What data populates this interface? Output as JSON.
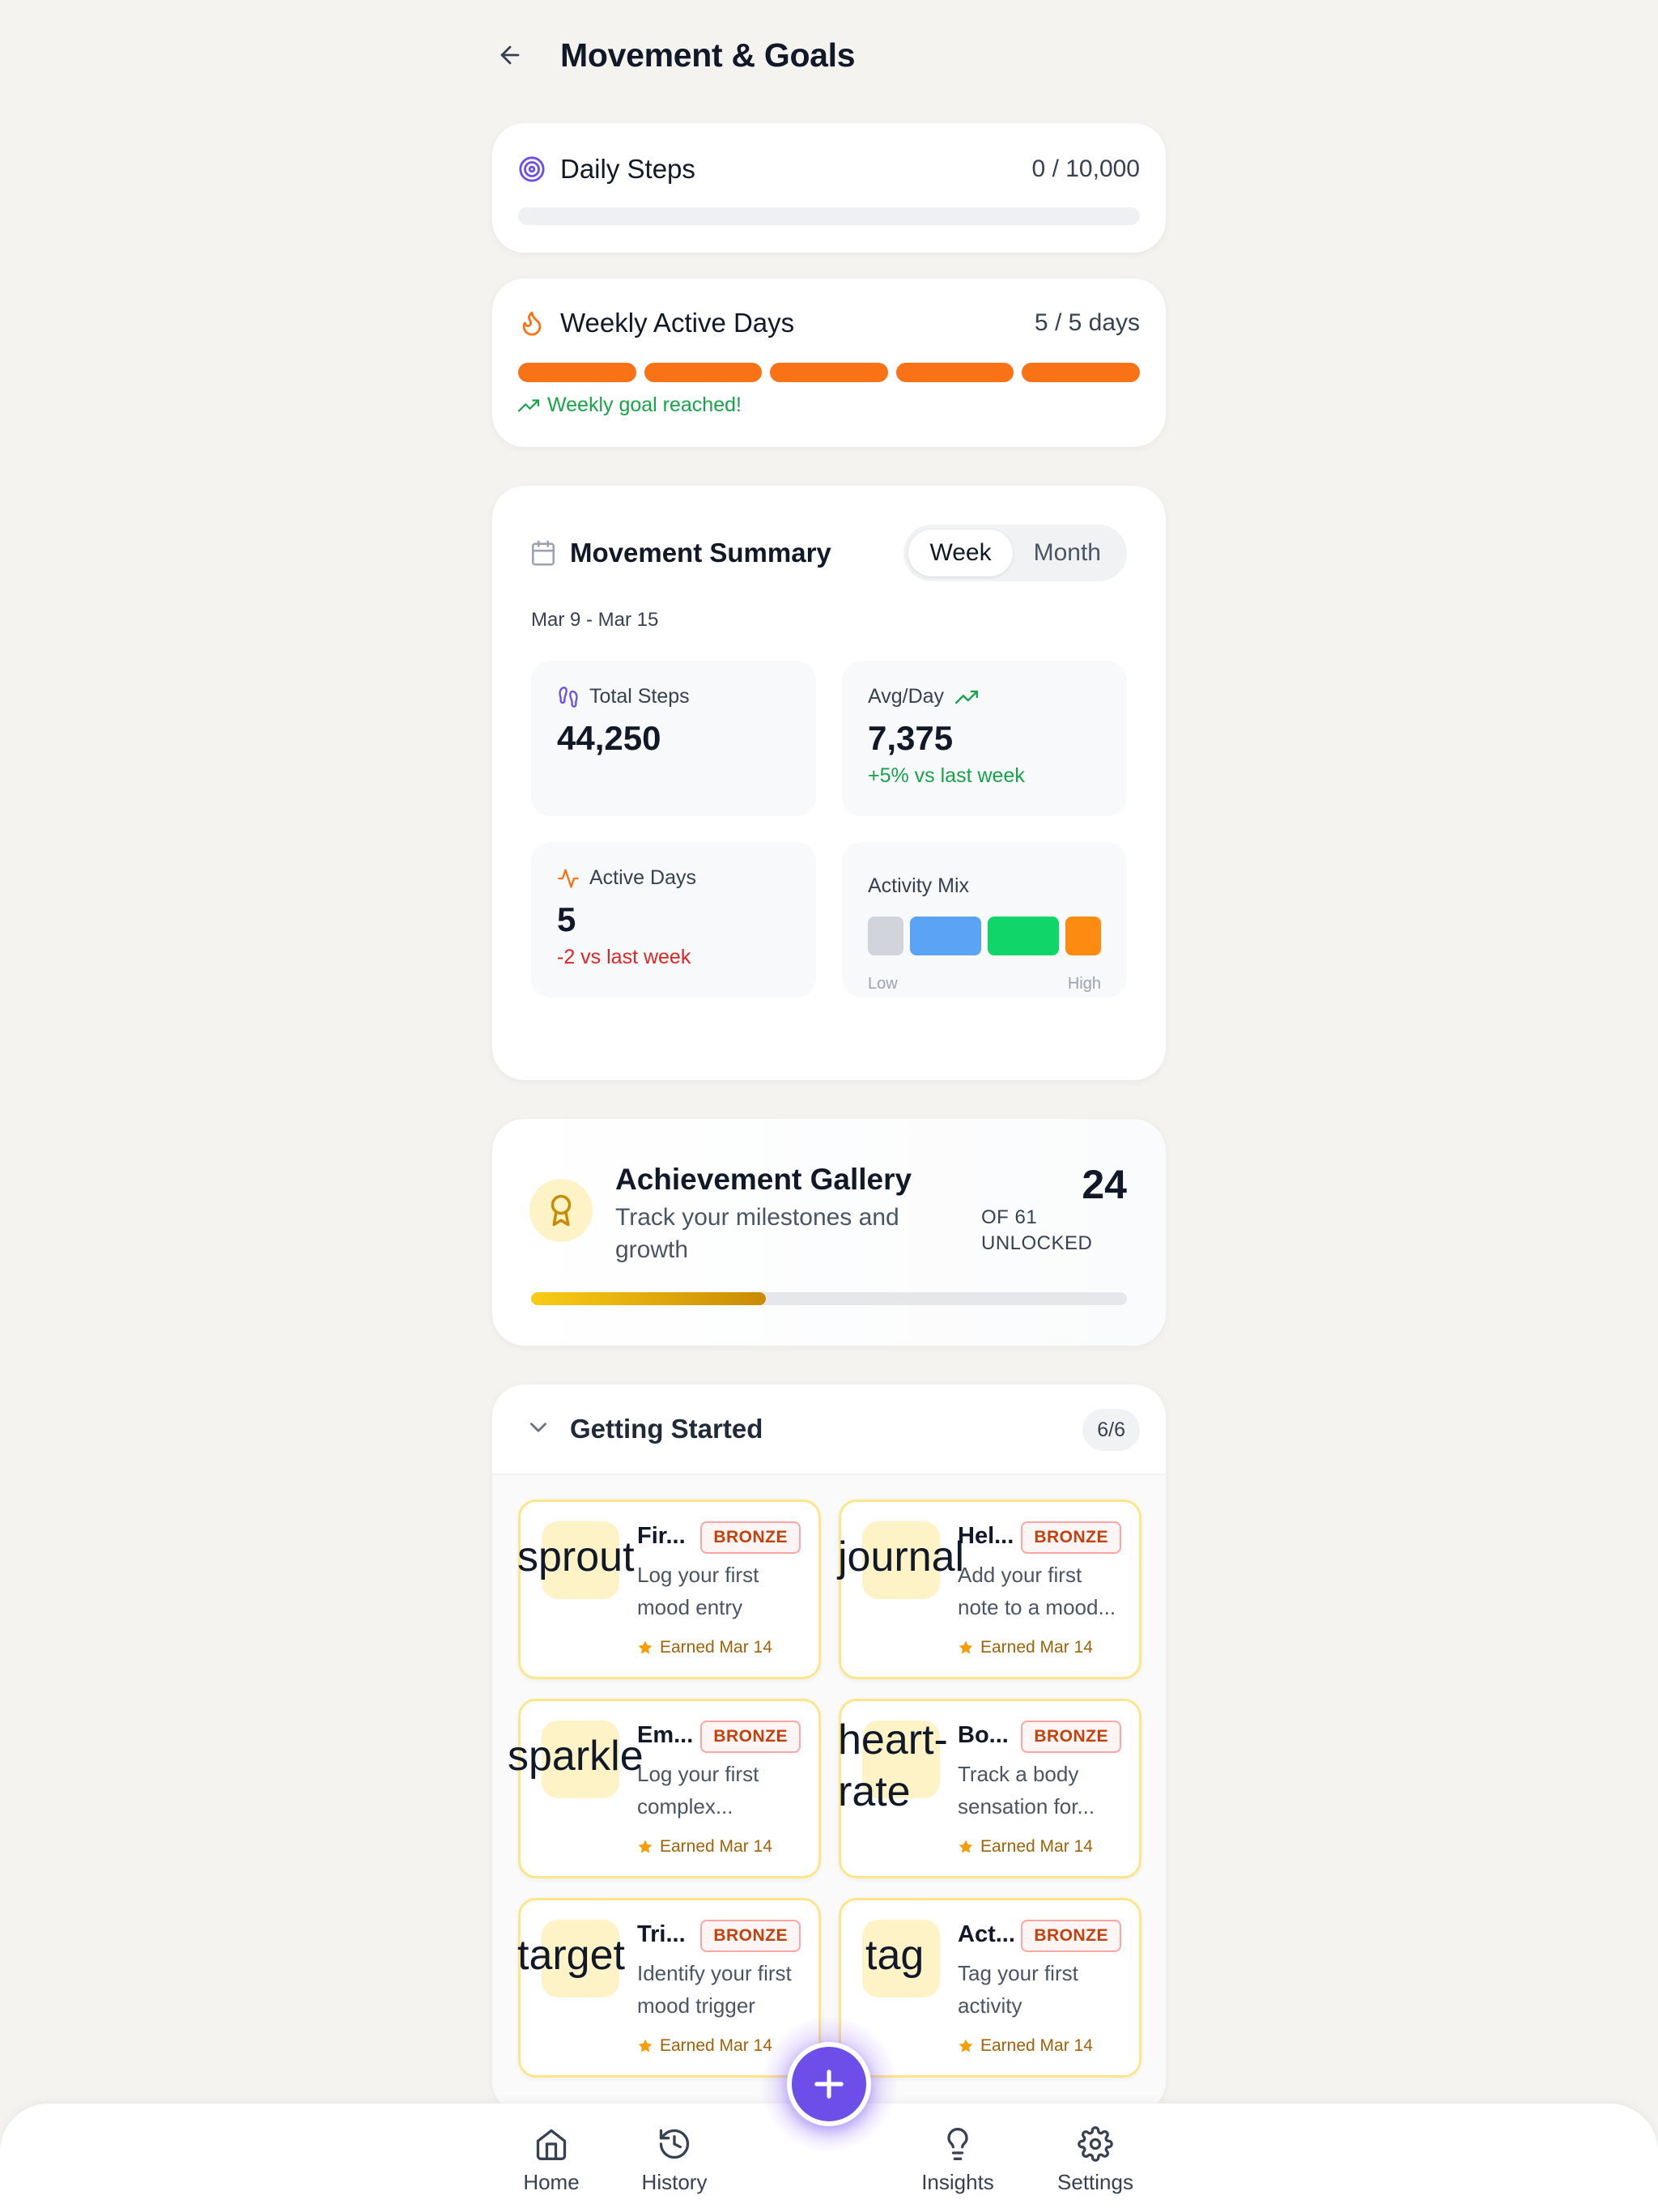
{
  "header": {
    "title": "Movement & Goals"
  },
  "daily_steps": {
    "label": "Daily Steps",
    "value": "0 / 10,000",
    "progress": 0
  },
  "weekly_active": {
    "label": "Weekly Active Days",
    "value": "5 / 5 days",
    "segments_filled": 5,
    "segments_total": 5,
    "note": "Weekly goal reached!"
  },
  "summary": {
    "title": "Movement Summary",
    "toggle": [
      "Week",
      "Month"
    ],
    "active_toggle": "Week",
    "range": "Mar 9 - Mar 15",
    "total_steps": {
      "label": "Total Steps",
      "value": "44,250"
    },
    "avg_day": {
      "label": "Avg/Day",
      "value": "7,375",
      "change": "+5% vs last week"
    },
    "active_days": {
      "label": "Active Days",
      "value": "5",
      "change": "-2 vs last week"
    },
    "activity_mix": {
      "label": "Activity Mix",
      "low": "Low",
      "high": "High",
      "colors": [
        "#d1d5db",
        "#5ba3f5",
        "#10d66a",
        "#fb8c10"
      ]
    }
  },
  "achievements": {
    "title": "Achievement Gallery",
    "subtitle": "Track your milestones and growth",
    "count": "24",
    "of_label_1": "OF 61",
    "of_label_2": "UNLOCKED",
    "progress": 0.3934
  },
  "getting_started": {
    "title": "Getting Started",
    "count": "6/6",
    "badges": [
      {
        "icon": "sprout",
        "name": "Fir...",
        "tier": "BRONZE",
        "desc": "Log your first mood entry",
        "earned": "Earned Mar 14"
      },
      {
        "icon": "journal",
        "name": "Hel...",
        "tier": "BRONZE",
        "desc": "Add your first note to a mood...",
        "earned": "Earned Mar 14"
      },
      {
        "icon": "sparkle",
        "name": "Em...",
        "tier": "BRONZE",
        "desc": "Log your first complex...",
        "earned": "Earned Mar 14"
      },
      {
        "icon": "heart-rate",
        "name": "Bo...",
        "tier": "BRONZE",
        "desc": "Track a body sensation for...",
        "earned": "Earned Mar 14"
      },
      {
        "icon": "target",
        "name": "Tri...",
        "tier": "BRONZE",
        "desc": "Identify your first mood trigger",
        "earned": "Earned Mar 14"
      },
      {
        "icon": "tag",
        "name": "Act...",
        "tier": "BRONZE",
        "desc": "Tag your first activity",
        "earned": "Earned Mar 14"
      }
    ]
  },
  "nav": {
    "home": "Home",
    "history": "History",
    "insights": "Insights",
    "settings": "Settings"
  },
  "colors": {
    "accent": "#6d4ee8",
    "orange": "#f97316",
    "green": "#16a34a",
    "red": "#dc2626"
  }
}
